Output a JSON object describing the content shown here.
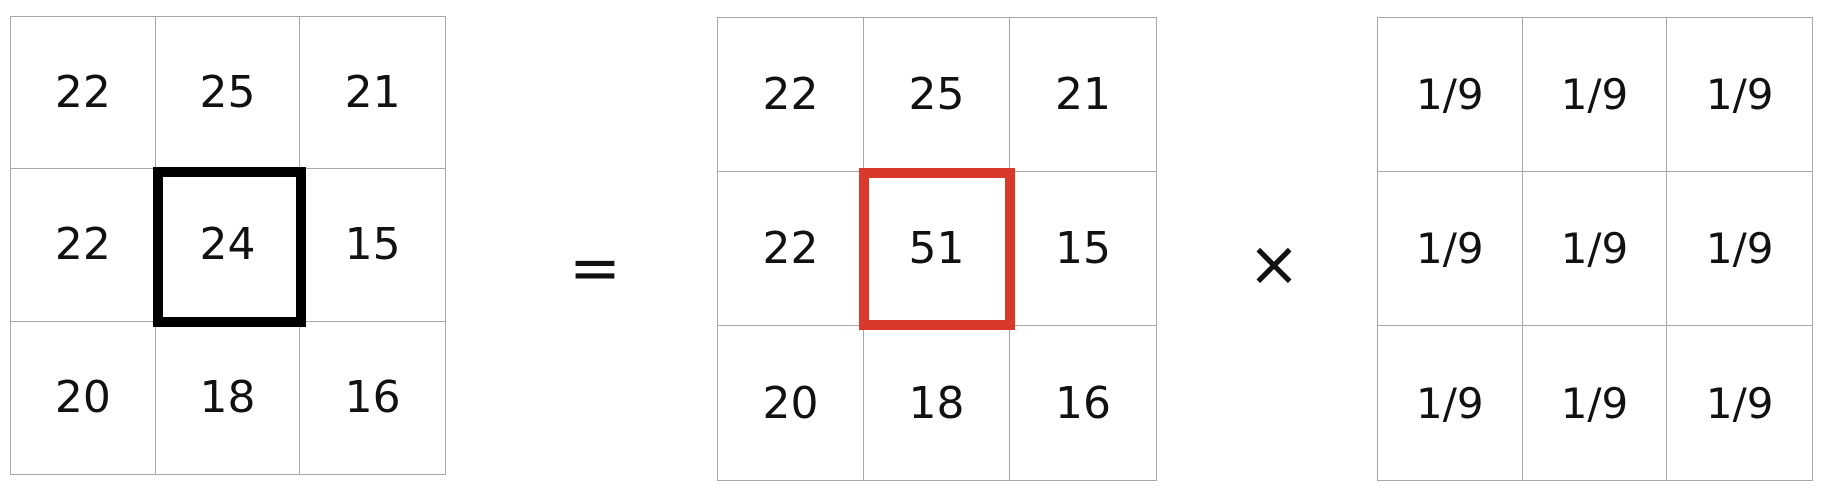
{
  "result_matrix": {
    "cells": [
      "22",
      "25",
      "21",
      "22",
      "24",
      "15",
      "20",
      "18",
      "16"
    ],
    "highlight_color": "#000000"
  },
  "equals_symbol": "=",
  "input_matrix": {
    "cells": [
      "22",
      "25",
      "21",
      "22",
      "51",
      "15",
      "20",
      "18",
      "16"
    ],
    "highlight_color": "#d9392a"
  },
  "times_symbol": "×",
  "kernel_matrix": {
    "cells": [
      "1/9",
      "1/9",
      "1/9",
      "1/9",
      "1/9",
      "1/9",
      "1/9",
      "1/9",
      "1/9"
    ]
  }
}
